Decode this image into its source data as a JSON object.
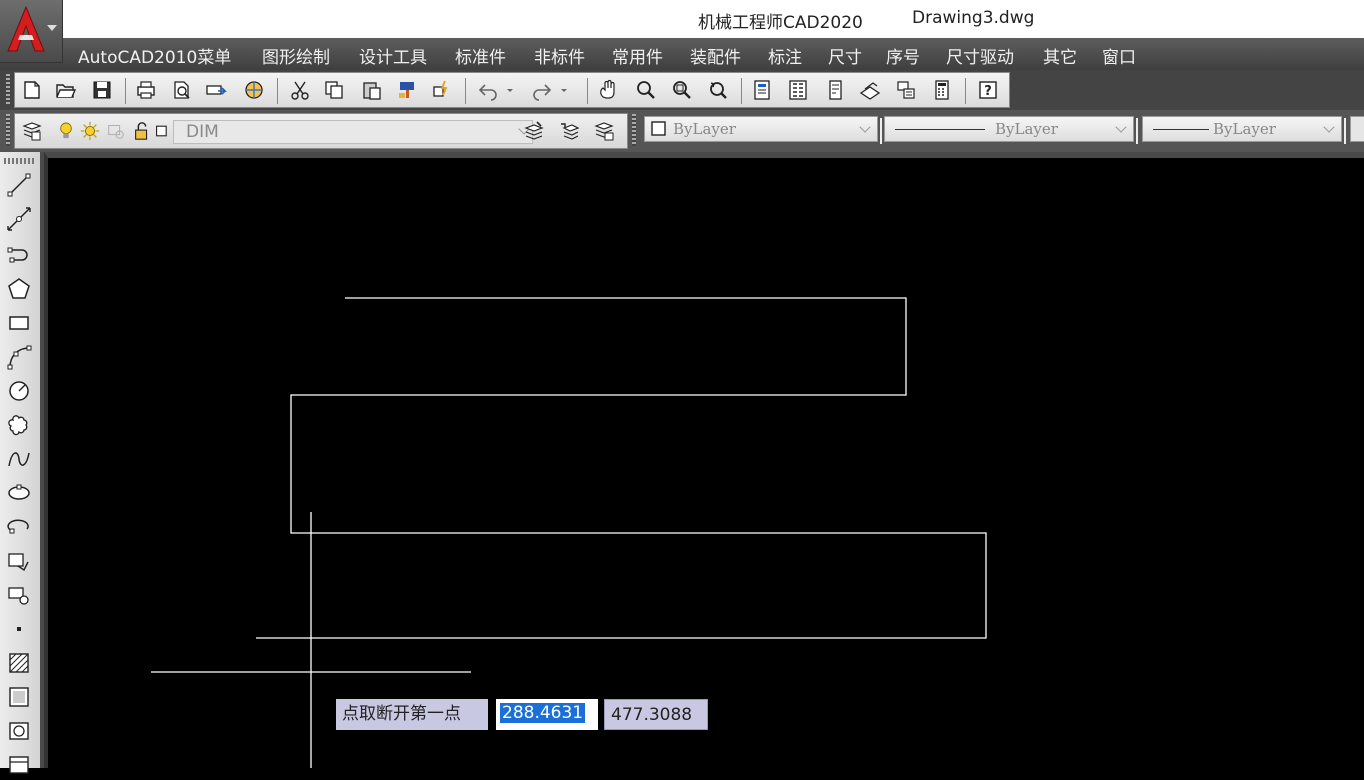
{
  "window": {
    "app_title": "机械工程师CAD2020",
    "file_name": "Drawing3.dwg"
  },
  "menu": {
    "items": [
      "AutoCAD2010菜单",
      "图形绘制",
      "设计工具",
      "标准件",
      "非标件",
      "常用件",
      "装配件",
      "标注",
      "尺寸",
      "序号",
      "尺寸驱动",
      "其它",
      "窗口"
    ]
  },
  "layers_toolbar": {
    "current_layer": "DIM"
  },
  "properties_toolbar": {
    "color": "ByLayer",
    "linetype": "ByLayer",
    "lineweight": "ByLayer"
  },
  "dynamic_input": {
    "prompt": "点取断开第一点",
    "x_value": "288.4631",
    "y_value": "477.3088"
  },
  "colors": {
    "canvas_bg": "#000000",
    "geometry": "#ffffff",
    "selection_highlight": "#1a6fd8"
  }
}
